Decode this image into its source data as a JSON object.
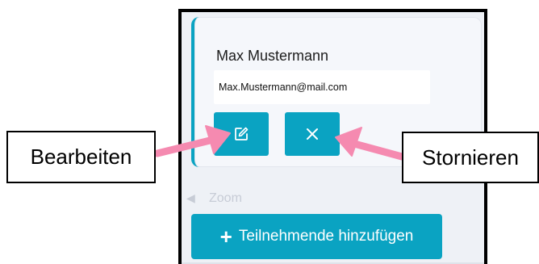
{
  "participant": {
    "name": "Max Mustermann",
    "email": "Max.Mustermann@mail.com"
  },
  "buttons": {
    "edit_icon": "edit-icon",
    "cancel_icon": "close-icon"
  },
  "zoom": {
    "label": "Zoom"
  },
  "add_button": {
    "plus": "+",
    "label": "Teilnehmende hinzufügen"
  },
  "callouts": {
    "left": "Bearbeiten",
    "right": "Stornieren"
  },
  "colors": {
    "accent": "#0aa3c2",
    "arrow": "#f58ab0"
  }
}
